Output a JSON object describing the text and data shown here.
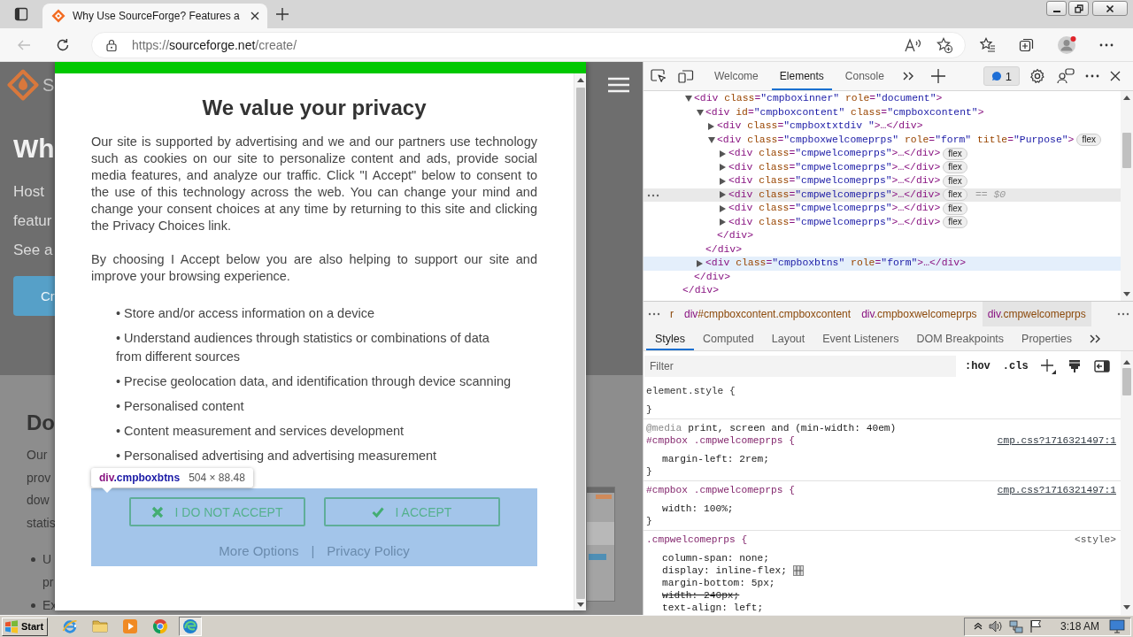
{
  "browser": {
    "tabs": [
      {
        "title": "Why Use SourceForge? Features a",
        "selected": true
      }
    ],
    "back_disabled": true,
    "address": {
      "scheme": "https://",
      "host": "sourceforge.net",
      "path": "/create/"
    }
  },
  "page": {
    "logo_text": "S",
    "heading": "Wh",
    "lines": [
      "Host",
      "featur",
      "See a"
    ],
    "button": "Cr",
    "section_heading": "Do",
    "section_lines": [
      "Our",
      "prov",
      "dow",
      "statis"
    ],
    "bullets": [
      [
        "U",
        "pr"
      ],
      [
        "Ex"
      ]
    ]
  },
  "consent": {
    "title": "We value your privacy",
    "paragraphs": [
      "Our site is supported by advertising and we and our partners use technology such as cookies on our site to personalize content and ads, provide social media features, and analyze our traffic. Click \"I Accept\" below to consent to the use of this technology across the web. You can change your mind and change your consent choices at any time by returning to this site and clicking the Privacy Choices link.",
      "By choosing I Accept below you are also helping to support our site and improve your browsing experience."
    ],
    "purposes": [
      "• Store and/or access information on a device",
      "• Understand audiences through statistics or combinations of data from different sources",
      "• Precise geolocation data, and identification through device scanning",
      "• Personalised content",
      "• Content measurement and services development",
      "• Personalised advertising and advertising measurement"
    ],
    "buttons": [
      {
        "kind": "reject",
        "label": "I DO NOT ACCEPT"
      },
      {
        "kind": "accept",
        "label": "I ACCEPT"
      }
    ],
    "links": [
      "More Options",
      "Privacy Policy"
    ],
    "link_separator": "|",
    "highlighted": true
  },
  "inspect_tooltip": {
    "tag": "div",
    "selector": ".cmpboxbtns",
    "size": "504 × 88.48"
  },
  "devtools": {
    "tabs": [
      {
        "label": "Welcome",
        "selected": false
      },
      {
        "label": "Elements",
        "selected": true
      },
      {
        "label": "Console",
        "selected": false
      }
    ],
    "issues": "1",
    "dom_tree": [
      {
        "close": "</div>",
        "children": [
          {
            "open": "<div class=\"cmpboxinner\" role=\"document\">",
            "expanded": true,
            "selected": false,
            "hovered": false,
            "close": "</div>",
            "children": [
              {
                "open": "<div id=\"cmpboxcontent\" class=\"cmpboxcontent\">",
                "expanded": true,
                "selected": false,
                "hovered": false,
                "close": "</div>",
                "children": [
                  {
                    "open": "<div class=\"cmpboxtxtdiv \">…</div>",
                    "expanded": false,
                    "selected": false,
                    "hovered": false
                  },
                  {
                    "open": "<div class=\"cmpboxwelcomeprps\" role=\"form\" title=\"Purpose\">",
                    "expanded": true,
                    "selected": false,
                    "hovered": false,
                    "badge": "flex",
                    "close": "</div>",
                    "children": [
                      {
                        "open": "<div class=\"cmpwelcomeprps\">…</div>",
                        "expanded": false,
                        "selected": false,
                        "hovered": false,
                        "badge": "flex"
                      },
                      {
                        "open": "<div class=\"cmpwelcomeprps\">…</div>",
                        "expanded": false,
                        "selected": false,
                        "hovered": false,
                        "badge": "flex"
                      },
                      {
                        "open": "<div class=\"cmpwelcomeprps\">…</div>",
                        "expanded": false,
                        "selected": false,
                        "hovered": false,
                        "badge": "flex"
                      },
                      {
                        "open": "<div class=\"cmpwelcomeprps\">…</div>",
                        "expanded": false,
                        "selected": true,
                        "hovered": false,
                        "badge": "flex",
                        "note": "== $0"
                      },
                      {
                        "open": "<div class=\"cmpwelcomeprps\">…</div>",
                        "expanded": false,
                        "selected": false,
                        "hovered": false,
                        "badge": "flex"
                      },
                      {
                        "open": "<div class=\"cmpwelcomeprps\">…</div>",
                        "expanded": false,
                        "selected": false,
                        "hovered": false,
                        "badge": "flex"
                      }
                    ]
                  }
                ]
              },
              {
                "open": "<div class=\"cmpboxbtns\" role=\"form\">…</div>",
                "expanded": false,
                "selected": false,
                "hovered": true
              }
            ]
          }
        ]
      }
    ],
    "breadcrumbs": [
      {
        "rest": "r",
        "selected": false
      },
      {
        "tag": "div",
        "rest": "#cmpboxcontent.cmpboxcontent",
        "selected": false
      },
      {
        "tag": "div",
        "rest": ".cmpboxwelcomeprps",
        "selected": false
      },
      {
        "tag": "div",
        "rest": ".cmpwelcomeprps",
        "selected": true
      }
    ],
    "sidebar_tabs": [
      {
        "label": "Styles",
        "selected": true
      },
      {
        "label": "Computed",
        "selected": false
      },
      {
        "label": "Layout",
        "selected": false
      },
      {
        "label": "Event Listeners",
        "selected": false
      },
      {
        "label": "DOM Breakpoints",
        "selected": false
      },
      {
        "label": "Properties",
        "selected": false
      }
    ],
    "filter": {
      "placeholder": "Filter"
    },
    "hov_toggle": ":hov",
    "cls_toggle": ".cls",
    "rules": [
      {
        "kind": "inline",
        "selector": "element.style {",
        "close": "}"
      },
      {
        "kind": "stylesheet",
        "media": {
          "at": "@media",
          "query": "print, screen and (min-width: 40em)"
        },
        "selector": "#cmpbox .cmpwelcomeprps {",
        "source": {
          "text": "cmp.css?1716321497:1",
          "link": true
        },
        "declarations": [
          {
            "text": "margin-left: 2rem;",
            "overridden": false,
            "flex_editor": false
          }
        ],
        "close": "}"
      },
      {
        "kind": "stylesheet",
        "selector": "#cmpbox .cmpwelcomeprps {",
        "source": {
          "text": "cmp.css?1716321497:1",
          "link": true
        },
        "declarations": [
          {
            "text": "width: 100%;",
            "overridden": false,
            "flex_editor": false
          }
        ],
        "close": "}"
      },
      {
        "kind": "stylesheet",
        "selector": ".cmpwelcomeprps {",
        "source": {
          "text": "<style>",
          "link": false
        },
        "declarations": [
          {
            "text": "column-span: none;",
            "overridden": false,
            "flex_editor": false
          },
          {
            "text": "display: inline-flex;",
            "overridden": false,
            "flex_editor": true
          },
          {
            "text": "margin-bottom: 5px;",
            "overridden": false,
            "flex_editor": false
          },
          {
            "text": "width: 240px;",
            "overridden": true,
            "flex_editor": false
          },
          {
            "text": "text-align: left;",
            "overridden": false,
            "flex_editor": false
          }
        ]
      }
    ]
  },
  "taskbar": {
    "start": "Start",
    "apps": [
      {
        "active": false
      },
      {
        "active": false
      },
      {
        "active": false
      },
      {
        "active": false
      },
      {
        "active": true
      }
    ],
    "clock": "3:18 AM"
  }
}
